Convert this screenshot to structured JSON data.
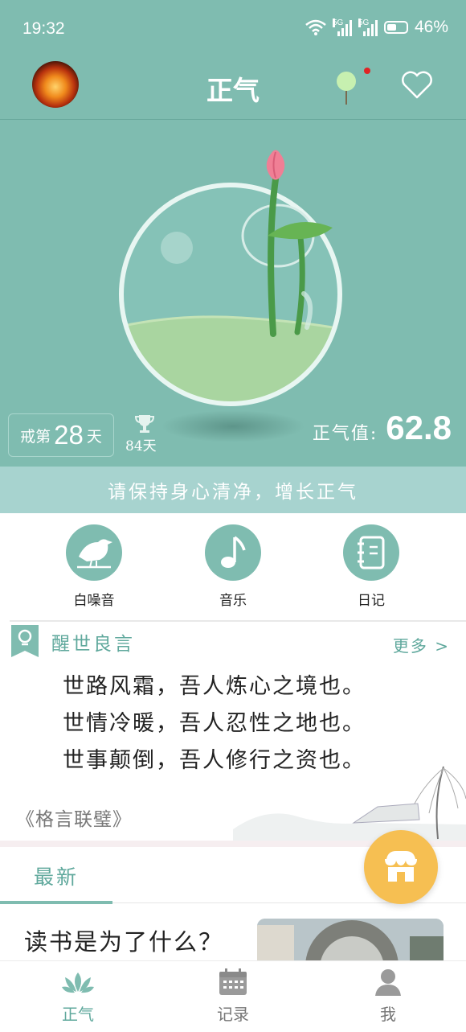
{
  "status": {
    "time": "19:32",
    "net1": "5G",
    "net2": "5G",
    "battery": "46%"
  },
  "header": {
    "title": "正气"
  },
  "stats": {
    "streak_prefix": "戒第",
    "streak_days": "28",
    "streak_suffix": "天",
    "best_record": "84天",
    "zhengqi_label": "正气值:",
    "zhengqi_value": "62.8"
  },
  "banner": "请保持身心清净，增长正气",
  "tools": [
    {
      "label": "白噪音",
      "icon": "bird-icon"
    },
    {
      "label": "音乐",
      "icon": "music-note-icon"
    },
    {
      "label": "日记",
      "icon": "notebook-icon"
    }
  ],
  "quote": {
    "section_title": "醒世良言",
    "more": "更多 >",
    "lines": [
      "世路风霜，吾人炼心之境也。",
      "世情冷暖，吾人忍性之地也。",
      "世事颠倒，吾人修行之资也。"
    ],
    "source": "《格言联璧》"
  },
  "feed": {
    "tab": "最新",
    "article_title": "读书是为了什么？"
  },
  "bottom_nav": [
    {
      "label": "正气",
      "icon": "lotus-icon",
      "active": true
    },
    {
      "label": "记录",
      "icon": "calendar-icon",
      "active": false
    },
    {
      "label": "我",
      "icon": "person-icon",
      "active": false
    }
  ],
  "colors": {
    "primary": "#7fbcb0",
    "accent_text": "#5fa89c",
    "fab": "#f6bf52",
    "notification": "#e02424"
  }
}
